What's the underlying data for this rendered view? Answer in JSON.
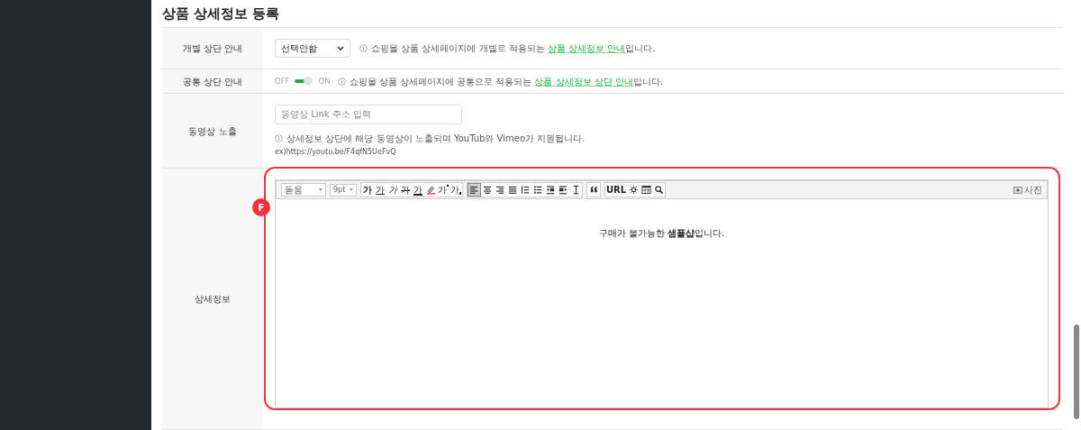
{
  "section_title": "상품 상세정보 등록",
  "rows": [
    {
      "kind": "select",
      "label": "개별 상단 안내",
      "select_value": "선택안함",
      "help_before": "쇼핑몰 상품 상세페이지에 개별로 적용되는 ",
      "help_link": "상품 상세정보 안내",
      "help_after": "입니다."
    },
    {
      "kind": "toggle",
      "label": "공통 상단 안내",
      "off_label": "OFF",
      "on_label": "ON",
      "on": true,
      "help_before": "쇼핑몰 상품 상세페이지에 공통으로 적용되는 ",
      "help_link": "상품 상세정보 상단 안내",
      "help_after": "입니다."
    },
    {
      "kind": "video",
      "label": "동영상 노출",
      "placeholder": "동영상 Link 주소 입력",
      "help": "상세정보 상단에 해당 동영상이 노출되며 YouTub와 Vimeo가 지원됩니다.",
      "example": "ex)https://youtu.be/F4qfN5UeFvQ"
    },
    {
      "kind": "editor",
      "label": "상세정보"
    }
  ],
  "editor": {
    "font": "돋움",
    "size": "9pt",
    "photo_label": "사진",
    "content": "구매가 불가능한 **샘플샵**입니다.",
    "groups": [
      [
        {
          "kind": "bold",
          "label": "가",
          "selected": false
        },
        {
          "kind": "underline",
          "label": "가",
          "selected": false
        },
        {
          "kind": "italic",
          "label": "가",
          "selected": false
        },
        {
          "kind": "strike",
          "label": "가",
          "selected": false
        },
        {
          "kind": "color",
          "label": "가",
          "selected": false
        },
        {
          "kind": "highlight",
          "selected": false
        },
        {
          "kind": "sup",
          "label": "가",
          "selected": false
        },
        {
          "kind": "sub",
          "label": "가",
          "selected": false
        }
      ],
      [
        {
          "kind": "align-left",
          "selected": true
        },
        {
          "kind": "align-center",
          "selected": false
        },
        {
          "kind": "align-right",
          "selected": false
        },
        {
          "kind": "justify",
          "selected": false
        },
        {
          "kind": "ordered-list",
          "selected": false
        },
        {
          "kind": "bullet-list",
          "selected": false
        },
        {
          "kind": "outdent",
          "selected": false
        },
        {
          "kind": "indent",
          "selected": false
        },
        {
          "kind": "line-height",
          "selected": false
        }
      ],
      [
        {
          "kind": "quote",
          "selected": false
        }
      ],
      [
        {
          "kind": "url",
          "label": "URL",
          "selected": false
        },
        {
          "kind": "special",
          "selected": false
        },
        {
          "kind": "table",
          "selected": false
        },
        {
          "kind": "search",
          "selected": false
        }
      ]
    ]
  },
  "annotation": {
    "badge": "F"
  }
}
